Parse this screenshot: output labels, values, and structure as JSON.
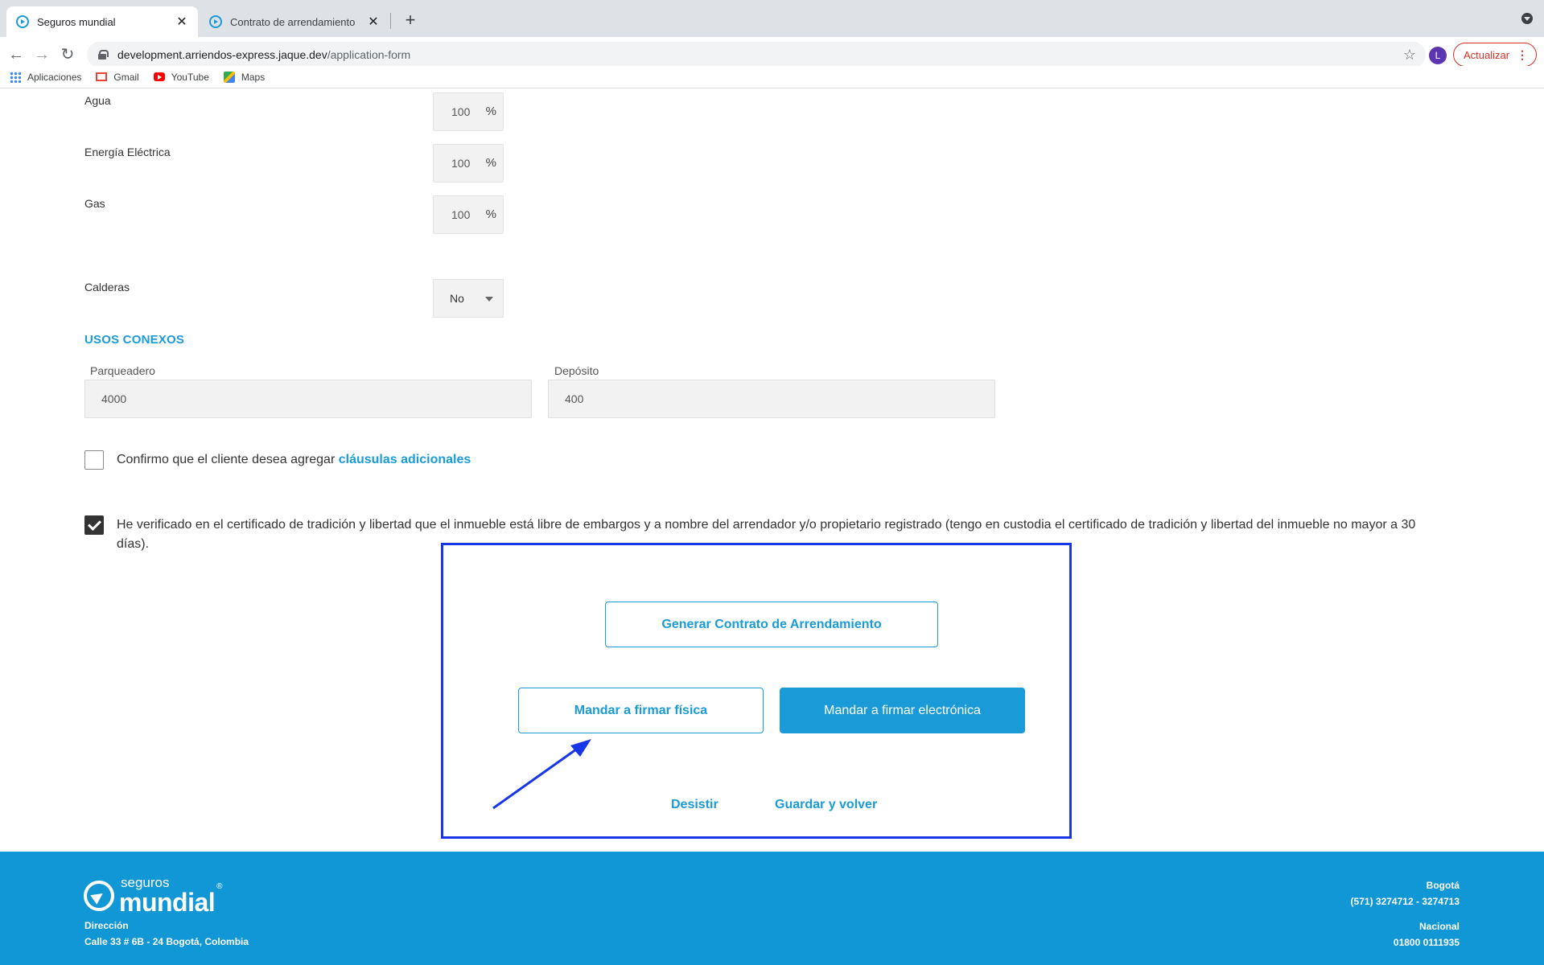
{
  "browser": {
    "tabs": [
      {
        "title": "Seguros mundial",
        "active": true
      },
      {
        "title": "Contrato de arrendamiento",
        "active": false
      }
    ],
    "url_host": "development.arriendos-express.jaque.dev",
    "url_path": "/application-form",
    "avatar_letter": "L",
    "update_label": "Actualizar",
    "bookmarks": [
      "Aplicaciones",
      "Gmail",
      "YouTube",
      "Maps"
    ]
  },
  "form": {
    "utilities": [
      {
        "label": "Agua",
        "value": "100",
        "unit": "%"
      },
      {
        "label": "Energía Eléctrica",
        "value": "100",
        "unit": "%"
      },
      {
        "label": "Gas",
        "value": "100",
        "unit": "%"
      }
    ],
    "calderas": {
      "label": "Calderas",
      "value": "No"
    },
    "section_title": "USOS CONEXOS",
    "parqueadero": {
      "label": "Parqueadero",
      "value": "4000"
    },
    "deposito": {
      "label": "Depósito",
      "value": "400"
    },
    "clausulas_text": "Confirmo que el cliente desea agregar",
    "clausulas_link": "cláusulas adicionales",
    "certificado_line1": "He verificado en el certificado de tradición y libertad que el inmueble está libre de embargos y a nombre del arrendador y/o propietario registrado (tengo en custodia el certificado de tradición y libertad del inmueble no mayor a 30",
    "certificado_line2": "días)."
  },
  "actions": {
    "generar": "Generar Contrato de Arrendamiento",
    "fisica": "Mandar a firmar física",
    "electronica": "Mandar a firmar electrónica",
    "desistir": "Desistir",
    "guardar": "Guardar y volver"
  },
  "footer": {
    "logo_small": "seguros",
    "logo_big": "mundial",
    "logo_reg": "®",
    "direccion_label": "Dirección",
    "direccion": "Calle 33 # 6B - 24 Bogotá, Colombia",
    "bogota_label": "Bogotá",
    "bogota_phone": "(571) 3274712 - 3274713",
    "nacional_label": "Nacional",
    "nacional_phone": "01800 0111935"
  },
  "colors": {
    "accent": "#1a9bd7",
    "footer": "#1196d6",
    "annotation": "#1836e8"
  }
}
